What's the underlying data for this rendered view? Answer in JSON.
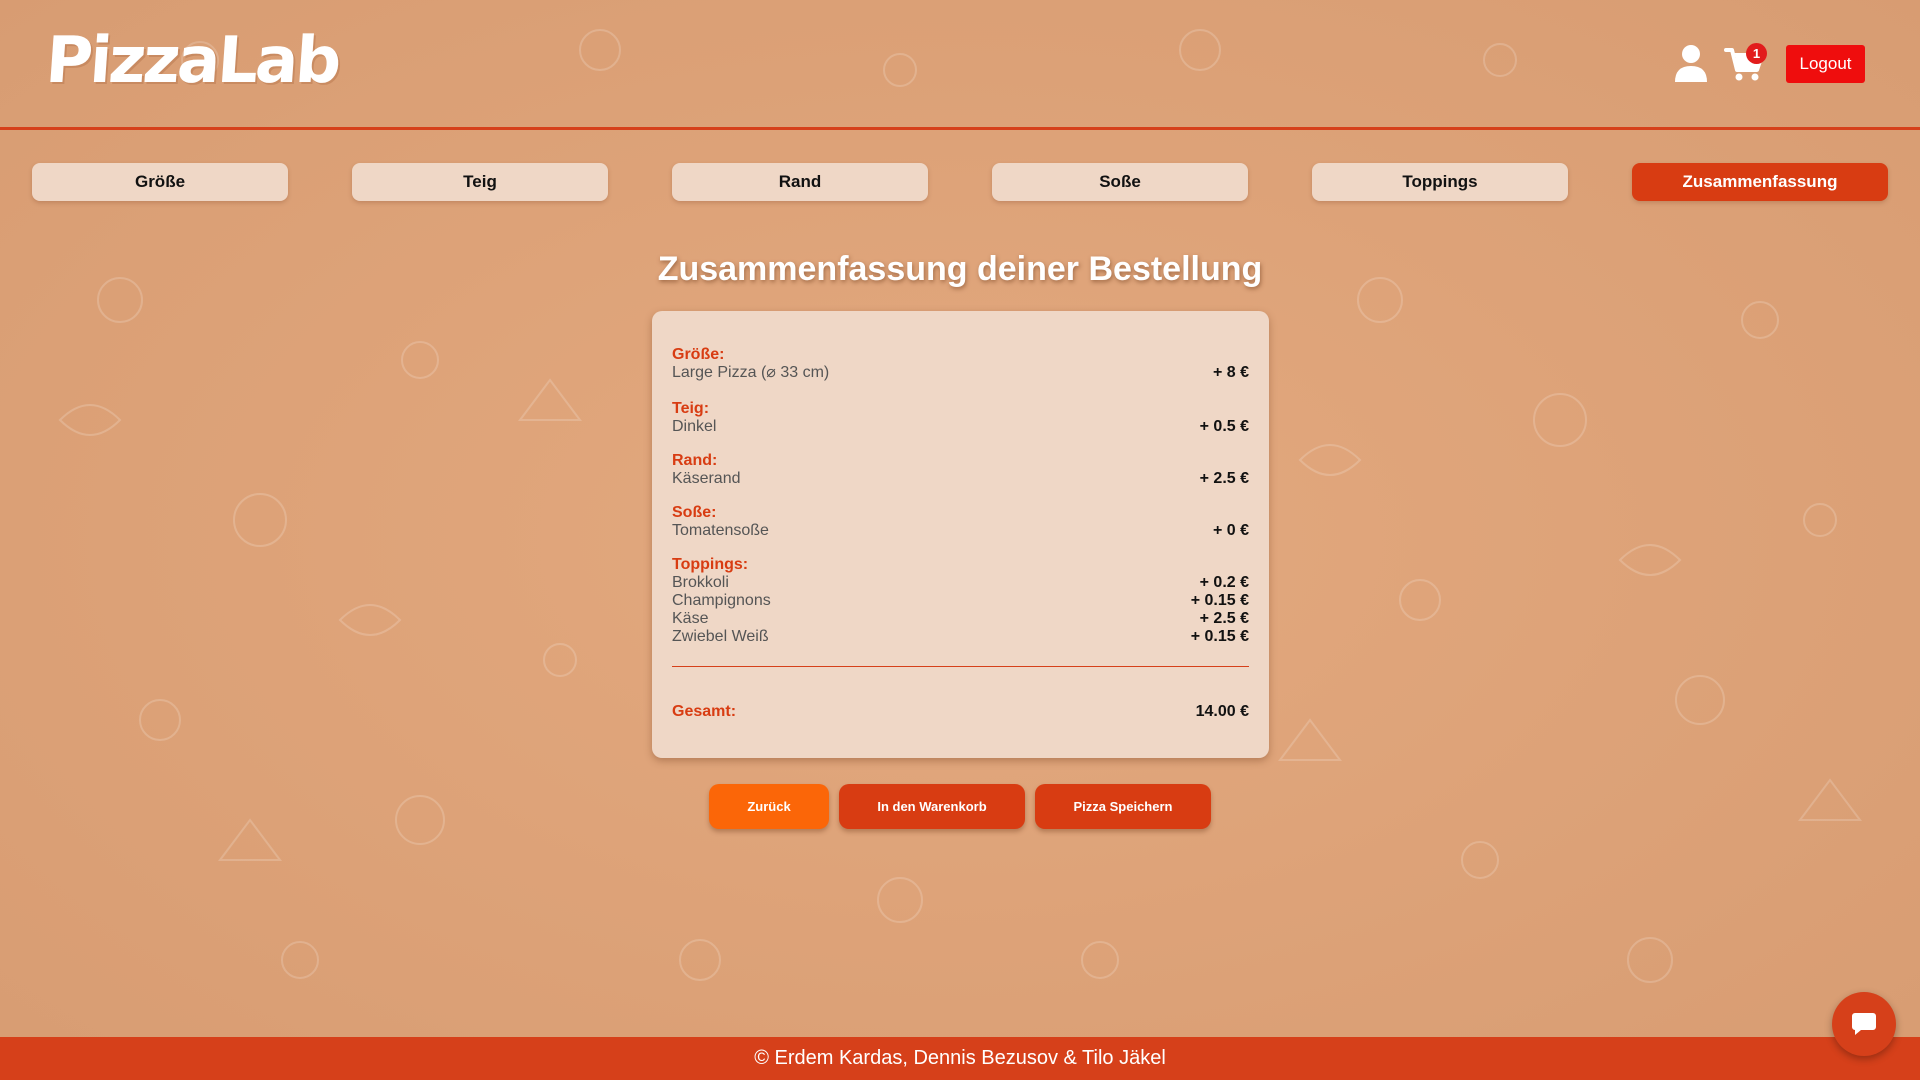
{
  "header": {
    "logo_text": "PizzaLab",
    "cart_count": "1",
    "logout_label": "Logout"
  },
  "steps": [
    {
      "label": "Größe",
      "active": false
    },
    {
      "label": "Teig",
      "active": false
    },
    {
      "label": "Rand",
      "active": false
    },
    {
      "label": "Soße",
      "active": false
    },
    {
      "label": "Toppings",
      "active": false
    },
    {
      "label": "Zusammenfassung",
      "active": true
    }
  ],
  "page_title": "Zusammenfassung deiner Bestellung",
  "summary": {
    "size": {
      "label": "Größe:",
      "name": "Large Pizza (⌀ 33 cm)",
      "price": "+ 8 €"
    },
    "dough": {
      "label": "Teig:",
      "name": "Dinkel",
      "price": "+ 0.5 €"
    },
    "crust": {
      "label": "Rand:",
      "name": "Käserand",
      "price": "+ 2.5 €"
    },
    "sauce": {
      "label": "Soße:",
      "name": "Tomatensoße",
      "price": "+ 0 €"
    },
    "toppings": {
      "label": "Toppings:",
      "items": [
        {
          "name": "Brokkoli",
          "price": "+ 0.2 €"
        },
        {
          "name": "Champignons",
          "price": "+ 0.15 €"
        },
        {
          "name": "Käse",
          "price": "+ 2.5 €"
        },
        {
          "name": "Zwiebel Weiß",
          "price": "+ 0.15 €"
        }
      ]
    },
    "total_label": "Gesamt:",
    "total_value": "14.00 €"
  },
  "actions": {
    "back": "Zurück",
    "add_to_cart": "In den Warenkorb",
    "save": "Pizza Speichern"
  },
  "footer": {
    "text": "© Erdem Kardas, Dennis Bezusov & Tilo Jäkel"
  },
  "colors": {
    "accent": "#d83c12",
    "orange": "#fb6608",
    "logout": "#ef0d0d",
    "background": "#e0a57a",
    "card": "#efd7c6"
  }
}
